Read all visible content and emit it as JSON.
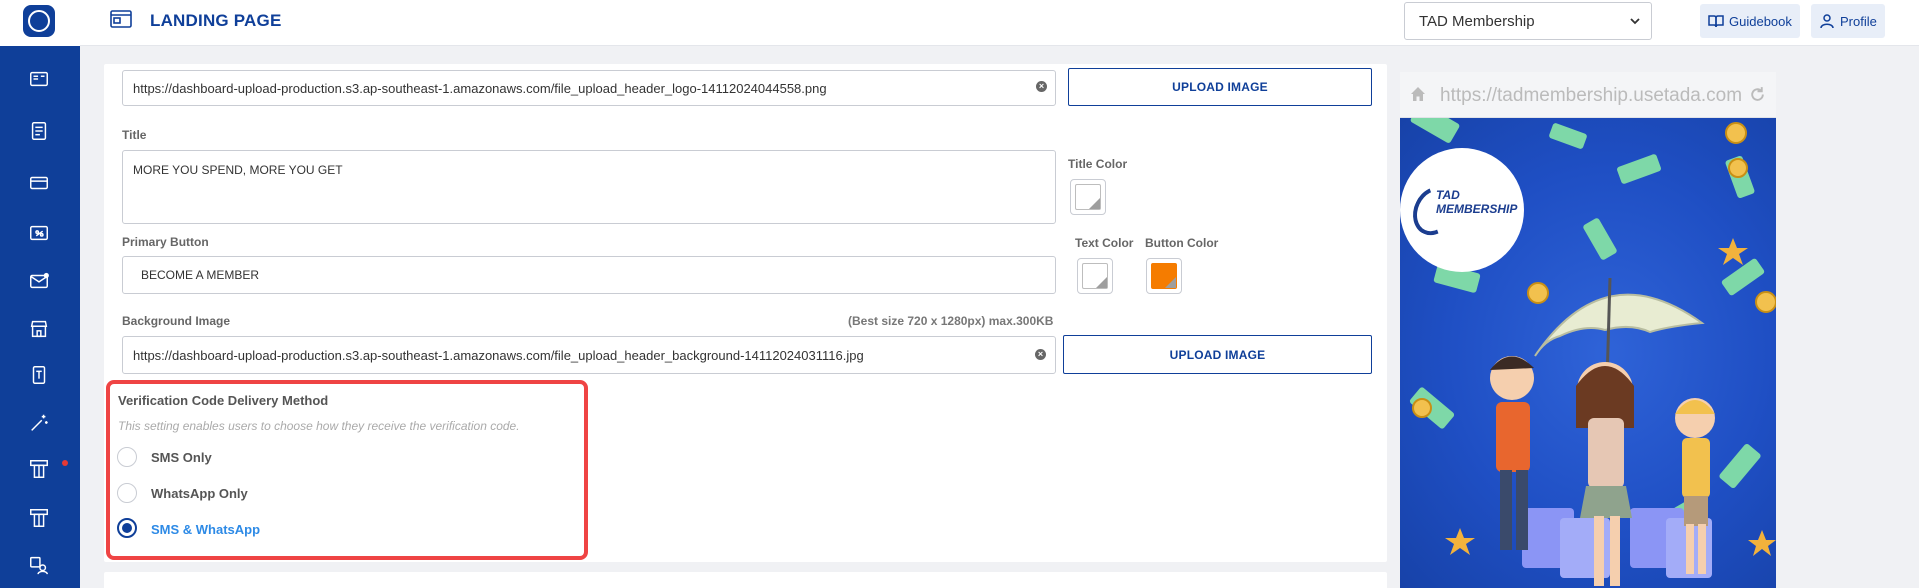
{
  "header": {
    "page_title": "LANDING PAGE",
    "brand_selected": "TAD Membership",
    "guidebook_label": "Guidebook",
    "profile_label": "Profile"
  },
  "form": {
    "header_logo_url": "https://dashboard-upload-production.s3.ap-southeast-1.amazonaws.com/file_upload_header_logo-14112024044558.png",
    "upload_button_label": "UPLOAD IMAGE",
    "title_label": "Title",
    "title_value": "MORE YOU SPEND, MORE YOU GET",
    "title_color_label": "Title Color",
    "primary_button_label": "Primary Button",
    "primary_button_value": "BECOME A MEMBER",
    "text_color_label": "Text Color",
    "button_color_label": "Button Color",
    "background_image_label": "Background Image",
    "background_image_hint": "(Best size 720 x 1280px) max.300KB",
    "background_image_url": "https://dashboard-upload-production.s3.ap-southeast-1.amazonaws.com/file_upload_header_background-14112024031116.jpg",
    "colors": {
      "title_color": "#ffffff",
      "text_color": "#ffffff",
      "button_color": "#f57c00"
    }
  },
  "verification": {
    "title": "Verification Code Delivery Method",
    "help": "This setting enables users to choose how they receive the verification code.",
    "options": [
      {
        "label": "SMS Only",
        "checked": false
      },
      {
        "label": "WhatsApp Only",
        "checked": false
      },
      {
        "label": "SMS & WhatsApp",
        "checked": true
      }
    ]
  },
  "preview": {
    "url": "https://tadmembership.usetada.com",
    "brand_line1": "TAD",
    "brand_line2": "MEMBERSHIP"
  },
  "sidebar_icons": [
    "dashboard-icon",
    "report-icon",
    "card-icon",
    "promo-icon",
    "mail-icon",
    "store-icon",
    "device-icon",
    "magic-wand-icon",
    "membership-icon",
    "membership-alt-icon",
    "user-management-icon"
  ],
  "theme": {
    "primary": "#0f3f99",
    "highlight_border": "#ef4444",
    "active_radio_text": "#2d8ae6"
  }
}
